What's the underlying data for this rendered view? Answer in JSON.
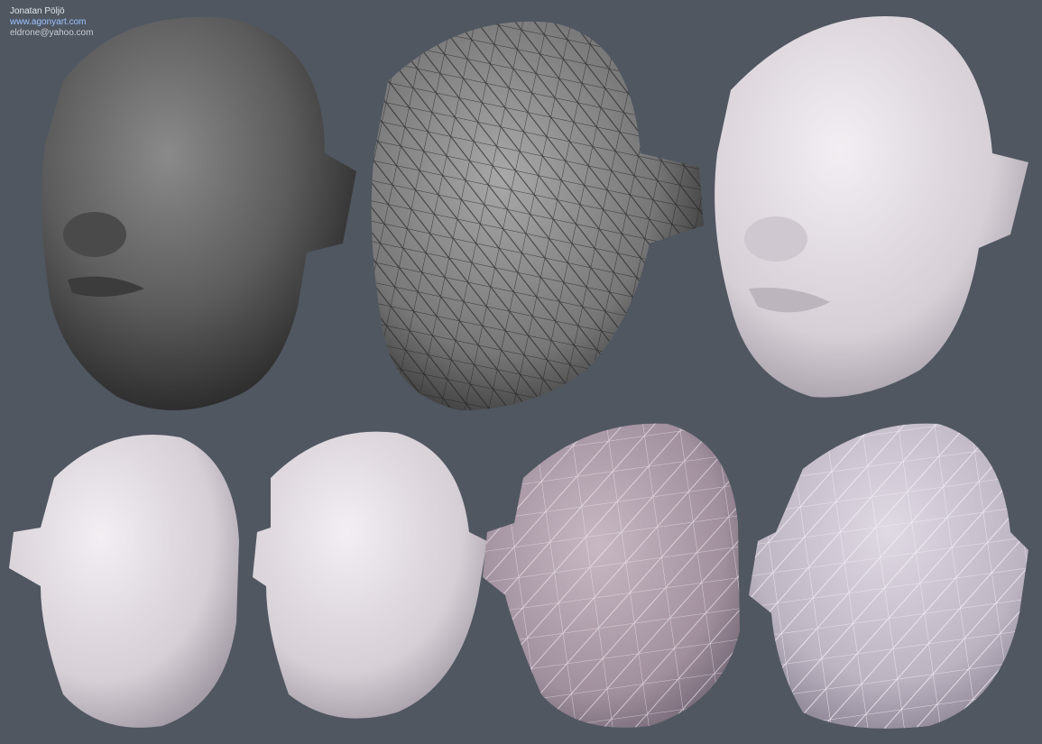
{
  "credits": {
    "author": "Jonatan Pöljö",
    "website": "www.agonyart.com",
    "email": "eldrone@yahoo.com"
  },
  "renders": [
    {
      "label": "dark-sculpt-head",
      "color": "#6a6a6a"
    },
    {
      "label": "lowpoly-wireframe-head",
      "color": "#8a8a8a"
    },
    {
      "label": "light-sculpt-head",
      "color": "#dcd6dc"
    },
    {
      "label": "light-head-side",
      "color": "#dcd6dc"
    },
    {
      "label": "light-head-front",
      "color": "#dcd6dc"
    },
    {
      "label": "wireframe-overlay-head",
      "color": "#b8a8b4"
    },
    {
      "label": "wireframe-back-head",
      "color": "#c8c0cc"
    }
  ],
  "colors": {
    "background": "#505761"
  }
}
